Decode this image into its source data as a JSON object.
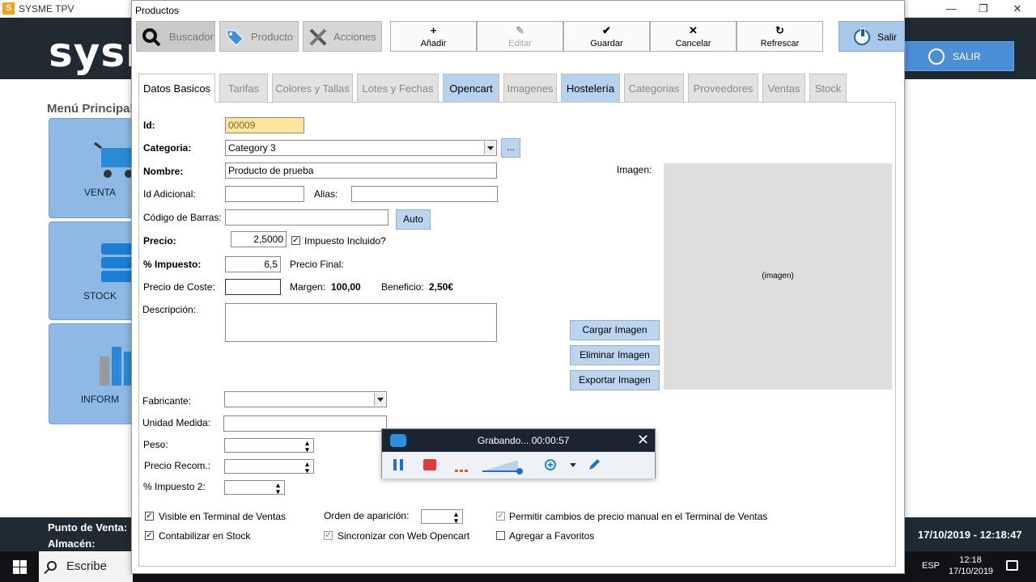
{
  "background": {
    "app_title": "SYSME TPV",
    "app_icon_letter": "S",
    "logo": "sysr",
    "salir": "SALIR",
    "menu_title": "Menú Principal",
    "tiles": [
      "VENTA",
      "STOCK",
      "INFORM"
    ],
    "status": {
      "punto_de_venta": "Punto de Venta:",
      "almacen": "Almacén:",
      "datetime": "17/10/2019 - 12:18:47"
    }
  },
  "taskbar": {
    "search_placeholder": "Escribe aquí",
    "lang": "ESP",
    "time": "12:18",
    "date": "17/10/2019"
  },
  "window": {
    "title": "Productos",
    "toolbar_tabs": [
      "Buscador",
      "Producto",
      "Acciones"
    ],
    "toolbar_buttons": [
      {
        "glyph": "+",
        "label": "Añadir",
        "enabled": true
      },
      {
        "glyph": "✎",
        "label": "Editar",
        "enabled": false
      },
      {
        "glyph": "✔",
        "label": "Guardar",
        "enabled": true
      },
      {
        "glyph": "✕",
        "label": "Cancelar",
        "enabled": true
      },
      {
        "glyph": "↻",
        "label": "Refrescar",
        "enabled": true
      }
    ],
    "salir": "Salir",
    "subtabs": [
      "Datos Basicos",
      "Tarifas",
      "Colores y Tallas",
      "Lotes y Fechas",
      "Opencart",
      "Imagenes",
      "Hostelería",
      "Categorias",
      "Proveedores",
      "Ventas",
      "Stock"
    ],
    "form": {
      "id_label": "Id:",
      "id_value": "00009",
      "categoria_label": "Categoria:",
      "categoria_value": "Category 3",
      "categoria_more": "...",
      "nombre_label": "Nombre:",
      "nombre_value": "Producto de prueba",
      "id_adicional_label": "Id Adicional:",
      "id_adicional_value": "",
      "alias_label": "Alias:",
      "alias_value": "",
      "codigo_label": "Código de Barras:",
      "codigo_value": "",
      "auto_button": "Auto",
      "precio_label": "Precio:",
      "precio_value": "2,5000",
      "impuesto_incluido": "Impuesto Incluido?",
      "impuesto_label": "% Impuesto:",
      "impuesto_value": "6,5",
      "precio_final_label": "Precio Final:",
      "coste_label": "Precio de Coste:",
      "coste_value": "",
      "margen_label": "Margen:",
      "margen_value": "100,00",
      "beneficio_label": "Beneficio:",
      "beneficio_value": "2,50€",
      "descripcion_label": "Descripción:",
      "descripcion_value": "",
      "imagen_label": "Imagen:",
      "imagen_placeholder": "(imagen)",
      "cargar": "Cargar Imagen",
      "eliminar": "Eliminar Imagen",
      "exportar": "Exportar Imagen",
      "fabricante_label": "Fabricante:",
      "fabricante_value": "",
      "unidad_label": "Unidad Medida:",
      "unidad_value": "",
      "peso_label": "Peso:",
      "peso_value": "",
      "recom_label": "Precio Recom.:",
      "recom_value": "",
      "impuesto2_label": "% Impuesto 2:",
      "impuesto2_value": "",
      "visible_tpv": "Visible en Terminal de Ventas",
      "contabilizar": "Contabilizar en Stock",
      "orden_label": "Orden de aparición:",
      "orden_value": "",
      "sincronizar": "Sincronizar con Web Opencart",
      "permitir": "Permitir cambios de precio manual en el Terminal de Ventas",
      "favoritos": "Agregar a Favoritos"
    }
  },
  "recorder": {
    "status": "Grabando... 00:00:57"
  }
}
